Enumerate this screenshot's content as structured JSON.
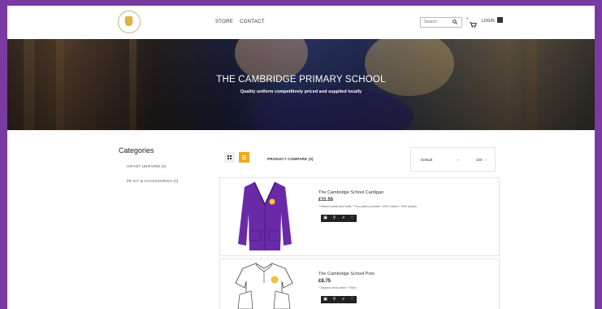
{
  "header": {
    "nav": [
      "STORE",
      "CONTACT"
    ],
    "search_placeholder": "Search",
    "cart_count": "0",
    "login_label": "LOGIN"
  },
  "hero": {
    "title": "THE CAMBRIDGE PRIMARY SCHOOL",
    "subtitle": "Quality uniform competitively priced and supplied locally"
  },
  "sidebar": {
    "title": "Categories",
    "items": [
      {
        "label": "INFANT UNIFORM (5)"
      },
      {
        "label": "PE KIT & ACCESSORIES (0)"
      }
    ]
  },
  "toolbar": {
    "compare_label": "PRODUCT COMPARE (0)",
    "sort_value": "Default",
    "limit_value": "100"
  },
  "products": [
    {
      "name": "The Cambridge School Cardigan",
      "price": "£11.55",
      "desc": "* Ribbed waist and cuffs   * Two patch pockets   * 65% cotton / 35% polyes"
    },
    {
      "name": "The Cambridge School Polo",
      "price": "£8.75",
      "desc": "* Tapped neck seam                    * Ribb"
    }
  ],
  "colors": {
    "accent": "#f5a623",
    "brand_purple": "#7a3aa3",
    "dark": "#222222"
  },
  "icons": [
    "search-icon",
    "cart-icon",
    "user-icon",
    "grid-view-icon",
    "list-view-icon",
    "cart-add-icon",
    "zoom-icon",
    "compare-icon",
    "heart-icon"
  ]
}
